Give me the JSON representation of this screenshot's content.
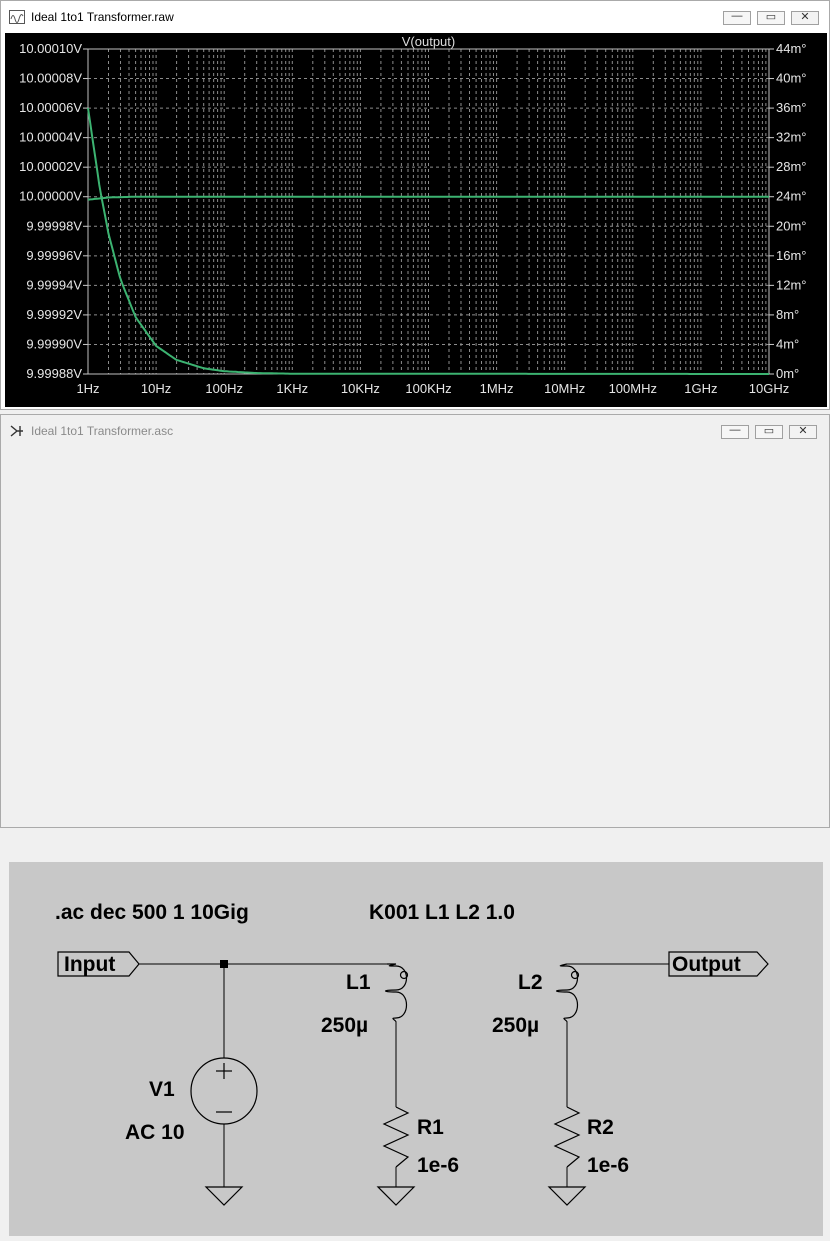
{
  "waveform_window": {
    "title": "Ideal 1to1 Transformer.raw",
    "buttons": {
      "minimize": "—",
      "maximize": "▭",
      "close": "✕"
    }
  },
  "schematic_window": {
    "title": "Ideal 1to1 Transformer.asc",
    "buttons": {
      "minimize": "—",
      "maximize": "▭",
      "close": "✕"
    }
  },
  "colors": {
    "trace": "#3cb371",
    "grid": "#8c8c8c",
    "plot_bg": "#000000",
    "schematic_bg": "#c8c8c8"
  },
  "chart_data": {
    "type": "line",
    "title": "V(output)",
    "xscale": "log",
    "x_ticks": [
      "1Hz",
      "10Hz",
      "100Hz",
      "1KHz",
      "10KHz",
      "100KHz",
      "1MHz",
      "10MHz",
      "100MHz",
      "1GHz",
      "10GHz"
    ],
    "y_left_ticks": [
      "10.00010V",
      "10.00008V",
      "10.00006V",
      "10.00004V",
      "10.00002V",
      "10.00000V",
      "9.99998V",
      "9.99996V",
      "9.99994V",
      "9.99992V",
      "9.99990V",
      "9.99988V"
    ],
    "y_right_ticks": [
      "44m°",
      "40m°",
      "36m°",
      "32m°",
      "28m°",
      "24m°",
      "20m°",
      "16m°",
      "12m°",
      "8m°",
      "4m°",
      "0m°"
    ],
    "ylim_left": [
      9.99988,
      10.0001
    ],
    "ylim_right": [
      0,
      44
    ],
    "grid": true,
    "series": [
      {
        "axis": "magnitude",
        "x": [
          1,
          2,
          5,
          10,
          1000,
          10000000000
        ],
        "values": [
          9.999998,
          9.9999995,
          10.0,
          10.0,
          10.0,
          10.0
        ]
      },
      {
        "axis": "phase",
        "x": [
          1,
          1.5,
          2,
          3,
          5,
          10,
          20,
          50,
          100,
          300,
          1000,
          10000000000
        ],
        "values": [
          36,
          25,
          19,
          12.8,
          7.7,
          3.8,
          1.9,
          0.77,
          0.38,
          0.13,
          0.04,
          0
        ]
      }
    ]
  },
  "schematic": {
    "directive_ac": ".ac dec 500 1 10Gig",
    "directive_k": "K001 L1 L2 1.0",
    "input_label": "Input",
    "output_label": "Output",
    "l1_name": "L1",
    "l1_value": "250µ",
    "l2_name": "L2",
    "l2_value": "250µ",
    "v1_name": "V1",
    "v1_value": "AC 10",
    "r1_name": "R1",
    "r1_value": "1e-6",
    "r2_name": "R2",
    "r2_value": "1e-6"
  }
}
